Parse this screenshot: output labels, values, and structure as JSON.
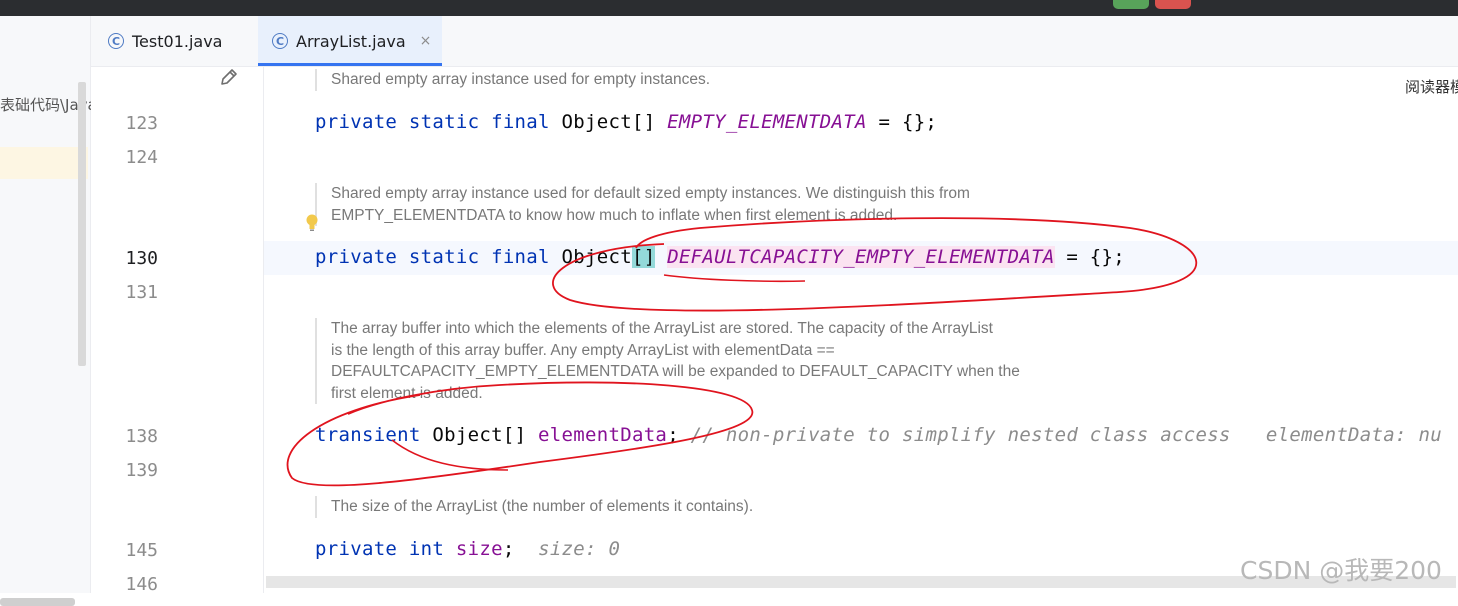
{
  "tabs": [
    {
      "icon": "class-icon",
      "label": "Test01.java"
    },
    {
      "icon": "class-icon",
      "label": "ArrayList.java",
      "close": "×"
    }
  ],
  "left_panel": {
    "path_text": "表础代码\\Java"
  },
  "right_panel": {
    "text": "阅读器模"
  },
  "line_numbers": [
    "123",
    "124",
    "130",
    "131",
    "138",
    "139",
    "145",
    "146"
  ],
  "docs": {
    "d1": "Shared empty array instance used for empty instances.",
    "d2_l1": "Shared empty array instance used for default sized empty instances. We distinguish this from",
    "d2_l2": "EMPTY_ELEMENTDATA to know how much to inflate when first element is added.",
    "d3_l1": "The array buffer into which the elements of the ArrayList are stored. The capacity of the ArrayList",
    "d3_l2": "is the length of this array buffer. Any empty ArrayList with elementData ==",
    "d3_l3": "DEFAULTCAPACITY_EMPTY_ELEMENTDATA will be expanded to DEFAULT_CAPACITY when the",
    "d3_l4": "first element is added.",
    "d4": "The size of the ArrayList (the number of elements it contains)."
  },
  "code": {
    "l123": {
      "kw": "private static final",
      "type": " Object[] ",
      "field": "EMPTY_ELEMENTDATA",
      "rest": " = {};"
    },
    "l130": {
      "kw": "private static final",
      "type_pre": " Object",
      "brackets": "[]",
      "sp": " ",
      "field": "DEFAULTCAPACITY_EMPTY_ELEMENTDATA",
      "rest": " = {};"
    },
    "l138": {
      "kw": "transient",
      "type": " Object[] ",
      "field": "elementData",
      "semi": ";",
      "comment": " // non-private to simplify nested class access",
      "hint": "   elementData: nu"
    },
    "l145": {
      "kw": "private int",
      "sp": " ",
      "field": "size",
      "semi": ";",
      "hint": "  size: 0"
    }
  },
  "watermark": "CSDN @我要200",
  "colors": {
    "keyword": "#0033b3",
    "field": "#871094",
    "annotation": "#e0141e",
    "tab_underline": "#3574f0"
  }
}
